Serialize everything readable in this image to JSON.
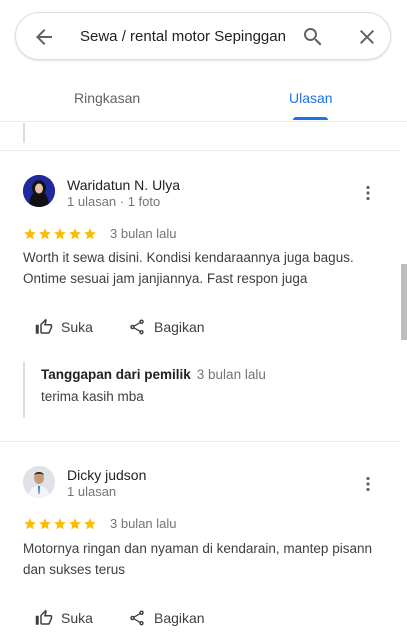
{
  "search": {
    "query": "Sewa / rental motor Sepinggan"
  },
  "tabs": [
    {
      "label": "Ringkasan",
      "active": false
    },
    {
      "label": "Ulasan",
      "active": true
    }
  ],
  "colors": {
    "accent": "#1a73e8",
    "star": "#fbbc04",
    "meta": "#70757a"
  },
  "actions": {
    "like_label": "Suka",
    "share_label": "Bagikan"
  },
  "reviews": [
    {
      "author": "Waridatun N. Ulya",
      "meta": "1 ulasan · 1 foto",
      "rating": 5,
      "time": "3 bulan lalu",
      "text": "Worth it sewa disini. Kondisi kendaraannya juga bagus. Ontime sesuai jam janjiannya. Fast respon juga",
      "avatar_icon": "hijab-woman-avatar",
      "owner_reply": {
        "label": "Tanggapan dari pemilik",
        "time": "3 bulan lalu",
        "text": "terima kasih mba"
      }
    },
    {
      "author": "Dicky judson",
      "meta": "1 ulasan",
      "rating": 5,
      "time": "3 bulan lalu",
      "text": "Motornya ringan dan nyaman di kendarain, mantep pisann dan sukses terus",
      "avatar_icon": "man-avatar"
    }
  ]
}
